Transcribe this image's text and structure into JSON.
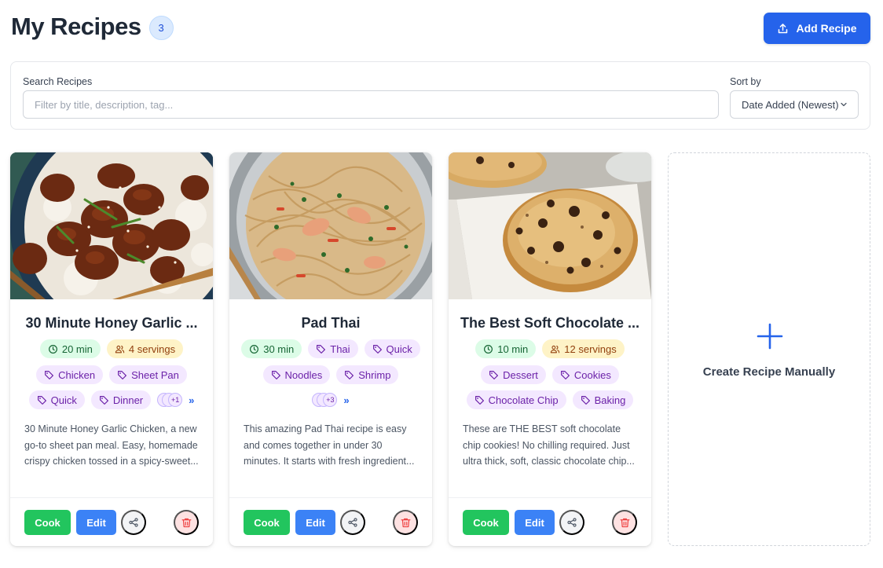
{
  "header": {
    "title": "My Recipes",
    "count": "3",
    "add_button": "Add Recipe"
  },
  "filters": {
    "search_label": "Search Recipes",
    "search_placeholder": "Filter by title, description, tag...",
    "search_value": "",
    "sort_label": "Sort by",
    "sort_value": "Date Added (Newest)"
  },
  "recipes": [
    {
      "title": "30 Minute Honey Garlic ...",
      "time": "20 min",
      "servings": "4 servings",
      "tags": [
        "Chicken",
        "Sheet Pan",
        "Quick",
        "Dinner"
      ],
      "more_count": "+1",
      "description": "30 Minute Honey Garlic Chicken, a new go-to sheet pan meal. Easy, homemade crispy chicken tossed in a spicy-sweet..."
    },
    {
      "title": "Pad Thai",
      "time": "30 min",
      "tags": [
        "Thai",
        "Quick",
        "Noodles",
        "Shrimp"
      ],
      "more_count": "+3",
      "description": "This amazing Pad Thai recipe is easy and comes together in under 30 minutes. It starts with fresh ingredient..."
    },
    {
      "title": "The Best Soft Chocolate ...",
      "time": "10 min",
      "servings": "12 servings",
      "tags": [
        "Dessert",
        "Cookies",
        "Chocolate Chip",
        "Baking"
      ],
      "description": "These are THE BEST soft chocolate chip cookies! No chilling required. Just ultra thick, soft, classic chocolate chip..."
    }
  ],
  "card_actions": {
    "cook": "Cook",
    "edit": "Edit"
  },
  "expand_symbol": "»",
  "create_card": {
    "label": "Create Recipe Manually"
  },
  "colors": {
    "primary": "#2563eb",
    "cook": "#22c55e",
    "edit": "#3b82f6",
    "time_chip_bg": "#dcfce7",
    "servings_chip_bg": "#fef3c7",
    "tag_chip_bg": "#f3e8ff",
    "delete_bg": "#fee2e2"
  },
  "icons": {
    "add": "upload-icon",
    "sort": "chevron-down-icon",
    "time": "clock-icon",
    "servings": "users-icon",
    "tag": "tag-icon",
    "share": "share-icon",
    "delete": "trash-icon",
    "create": "plus-icon"
  }
}
